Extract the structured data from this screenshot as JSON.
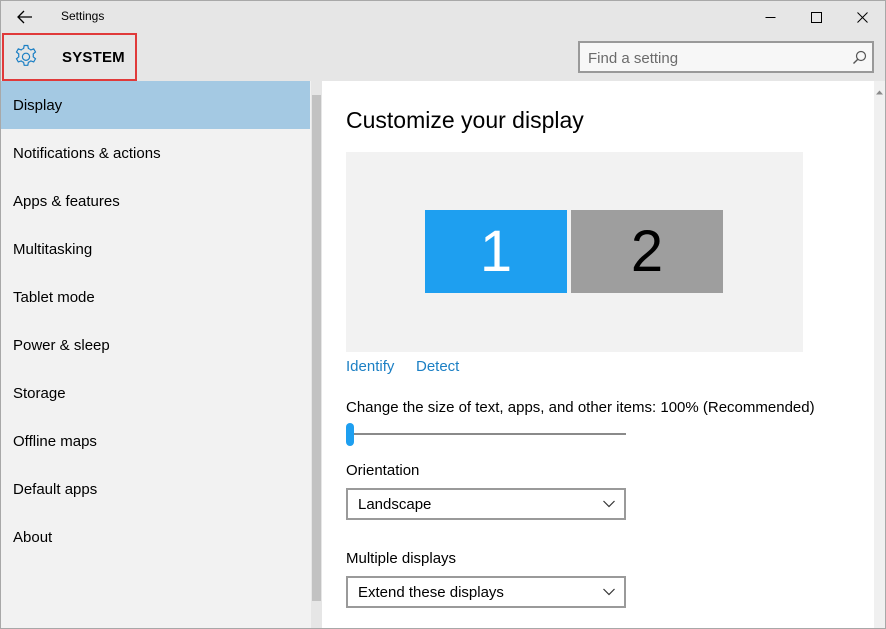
{
  "window": {
    "title": "Settings"
  },
  "header": {
    "section_title": "SYSTEM",
    "search_placeholder": "Find a setting"
  },
  "sidebar": {
    "items": [
      {
        "label": "Display",
        "selected": true
      },
      {
        "label": "Notifications & actions",
        "selected": false
      },
      {
        "label": "Apps & features",
        "selected": false
      },
      {
        "label": "Multitasking",
        "selected": false
      },
      {
        "label": "Tablet mode",
        "selected": false
      },
      {
        "label": "Power & sleep",
        "selected": false
      },
      {
        "label": "Storage",
        "selected": false
      },
      {
        "label": "Offline maps",
        "selected": false
      },
      {
        "label": "Default apps",
        "selected": false
      },
      {
        "label": "About",
        "selected": false
      }
    ]
  },
  "main": {
    "title": "Customize your display",
    "monitors": [
      "1",
      "2"
    ],
    "identify_label": "Identify",
    "detect_label": "Detect",
    "scale_label": "Change the size of text, apps, and other items: 100% (Recommended)",
    "scale_slider_fraction": 0.0,
    "orientation_label": "Orientation",
    "orientation_value": "Landscape",
    "multiple_displays_label": "Multiple displays",
    "multiple_displays_value": "Extend these displays"
  },
  "colors": {
    "accent": "#1e9ff0",
    "selected_nav": "#a4c9e3",
    "link": "#1b7fc4",
    "highlight_border": "#e03a3a"
  },
  "icons": {
    "back": "back-arrow-icon",
    "gear": "gear-icon",
    "search": "search-icon",
    "minimize": "minimize-icon",
    "maximize": "maximize-icon",
    "close": "close-icon",
    "chevron": "chevron-down-icon"
  }
}
